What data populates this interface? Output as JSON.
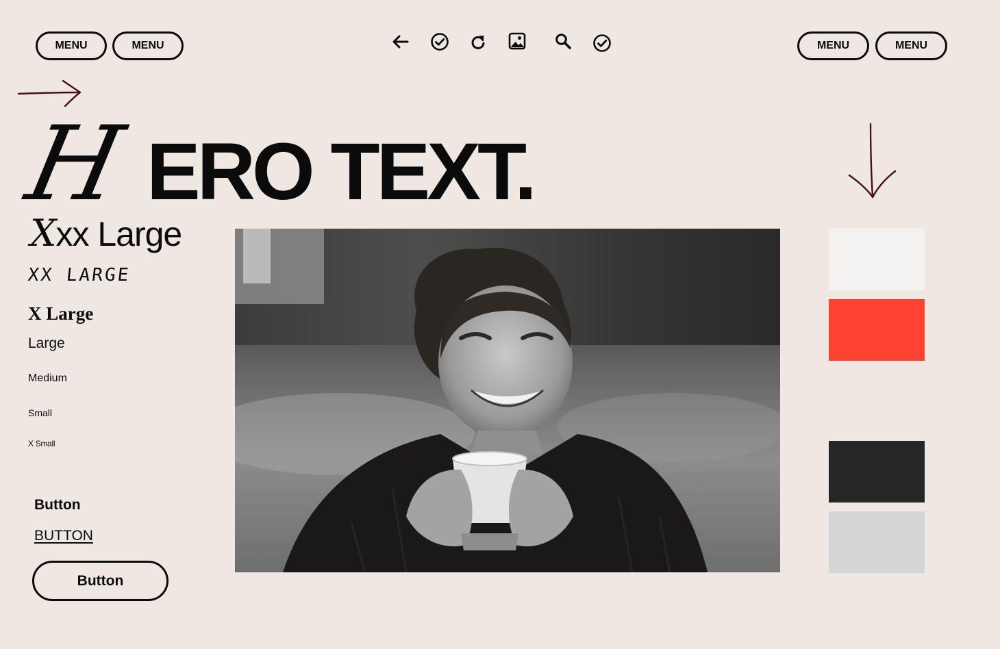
{
  "nav": {
    "left": [
      {
        "label": "MENU"
      },
      {
        "label": "MENU"
      }
    ],
    "right": [
      {
        "label": "MENU"
      },
      {
        "label": "MENU"
      }
    ],
    "tools": [
      "back-arrow-icon",
      "check-circle-icon",
      "refresh-icon",
      "image-icon",
      "search-icon",
      "check-circle-icon"
    ]
  },
  "hero": {
    "initial": "H",
    "rest": "ERO TEXT."
  },
  "type_scale": {
    "xxx_initial": "X",
    "xxx_rest": "xx Large",
    "xx": "XX LARGE",
    "x": "X Large",
    "large": "Large",
    "medium": "Medium",
    "small": "Small",
    "xsmall": "X Small"
  },
  "buttons": {
    "bold": "Button",
    "underlined": "BUTTON",
    "outline": "Button"
  },
  "swatches": [
    "#f3f2f0",
    "#ff4330",
    "#262626",
    "#d5d5d5"
  ],
  "colors": {
    "background": "#efe8e2",
    "ink": "#0b0b0b",
    "arrow": "#4a0f13"
  }
}
